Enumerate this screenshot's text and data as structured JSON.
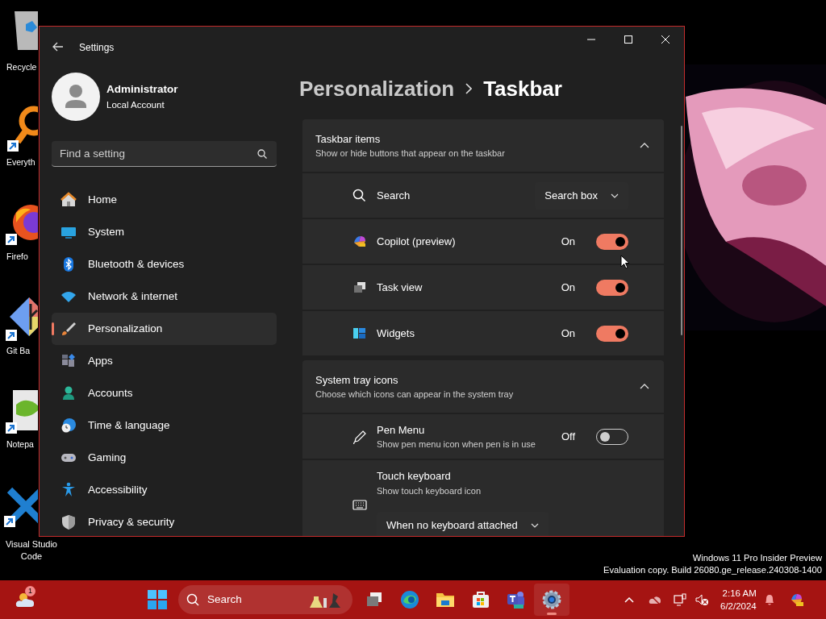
{
  "desktop": {
    "icons": [
      {
        "label": "Recycle"
      },
      {
        "label": "Everyth"
      },
      {
        "label": "Firefo"
      },
      {
        "label": "Git Ba"
      },
      {
        "label": "Notepa"
      },
      {
        "label": "Visual Studio Code"
      }
    ],
    "watermark": [
      "Windows 11 Pro Insider Preview",
      "Evaluation copy. Build 26080.ge_release.240308-1400"
    ]
  },
  "window": {
    "title": "Settings",
    "user": {
      "name": "Administrator",
      "account": "Local Account"
    },
    "search": {
      "placeholder": "Find a setting"
    },
    "nav": [
      {
        "label": "Home",
        "selected": false
      },
      {
        "label": "System",
        "selected": false
      },
      {
        "label": "Bluetooth & devices",
        "selected": false
      },
      {
        "label": "Network & internet",
        "selected": false
      },
      {
        "label": "Personalization",
        "selected": true
      },
      {
        "label": "Apps",
        "selected": false
      },
      {
        "label": "Accounts",
        "selected": false
      },
      {
        "label": "Time & language",
        "selected": false
      },
      {
        "label": "Gaming",
        "selected": false
      },
      {
        "label": "Accessibility",
        "selected": false
      },
      {
        "label": "Privacy & security",
        "selected": false
      }
    ],
    "breadcrumb": {
      "parent": "Personalization",
      "current": "Taskbar"
    },
    "sections": [
      {
        "title": "Taskbar items",
        "subtitle": "Show or hide buttons that appear on the taskbar",
        "expanded": true,
        "rows": [
          {
            "kind": "dropdown",
            "label": "Search",
            "value": "Search box"
          },
          {
            "kind": "toggle",
            "label": "Copilot (preview)",
            "state_text": "On",
            "on": true
          },
          {
            "kind": "toggle",
            "label": "Task view",
            "state_text": "On",
            "on": true
          },
          {
            "kind": "toggle",
            "label": "Widgets",
            "state_text": "On",
            "on": true
          }
        ]
      },
      {
        "title": "System tray icons",
        "subtitle": "Choose which icons can appear in the system tray",
        "expanded": true,
        "rows": [
          {
            "kind": "toggle",
            "label": "Pen Menu",
            "description": "Show pen menu icon when pen is in use",
            "state_text": "Off",
            "on": false
          },
          {
            "kind": "stacked-dropdown",
            "label": "Touch keyboard",
            "description": "Show touch keyboard icon",
            "value": "When no keyboard attached"
          }
        ]
      }
    ]
  },
  "taskbar": {
    "weather_badge": "1",
    "search_label": "Search",
    "apps": [
      {
        "selected": false
      },
      {
        "selected": false
      },
      {
        "selected": false
      },
      {
        "selected": false
      },
      {
        "selected": false
      },
      {
        "selected": true
      }
    ],
    "clock": {
      "time": "2:16 AM",
      "date": "6/2/2024"
    }
  }
}
